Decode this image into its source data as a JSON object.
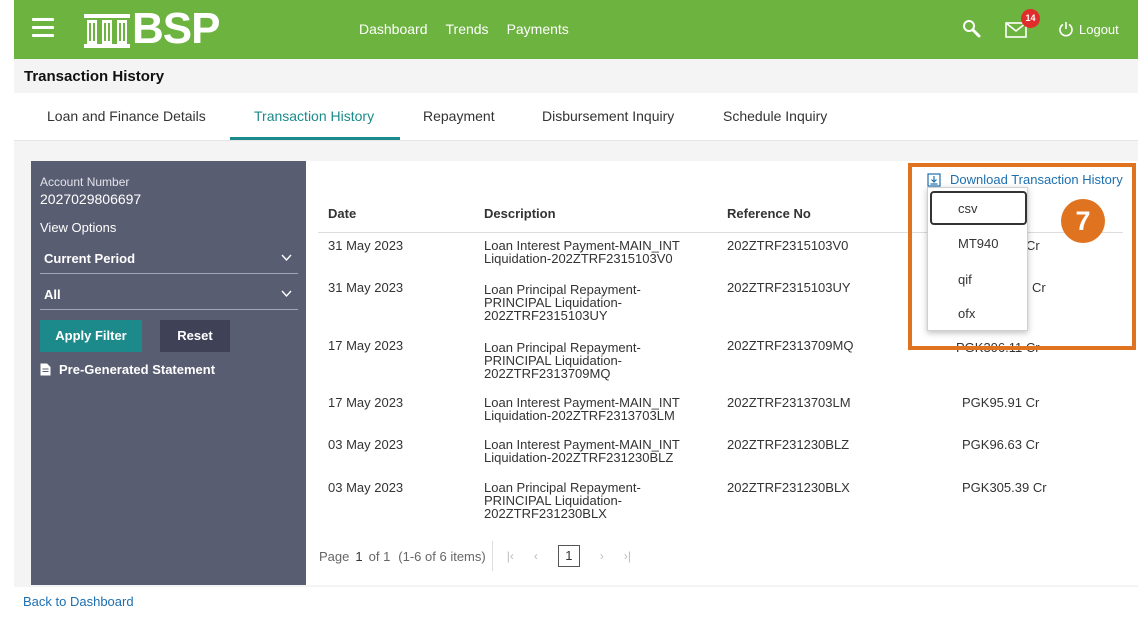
{
  "header": {
    "logo_text": "BSP",
    "nav": [
      "Dashboard",
      "Trends",
      "Payments"
    ],
    "mail_badge": "14",
    "logout_label": "Logout"
  },
  "page_title": "Transaction History",
  "tabs": [
    {
      "label": "Loan and Finance Details"
    },
    {
      "label": "Transaction History"
    },
    {
      "label": "Repayment"
    },
    {
      "label": "Disbursement Inquiry"
    },
    {
      "label": "Schedule Inquiry"
    }
  ],
  "filter": {
    "account_label": "Account Number",
    "account_number": "2027029806697",
    "view_options_label": "View Options",
    "period_value": "Current Period",
    "type_value": "All",
    "apply_label": "Apply Filter",
    "reset_label": "Reset",
    "pregenerated_label": "Pre-Generated Statement"
  },
  "download": {
    "link_label": "Download Transaction History",
    "options": [
      "csv",
      "MT940",
      "qif",
      "ofx"
    ]
  },
  "table": {
    "columns": [
      "Date",
      "Description",
      "Reference No"
    ],
    "rows": [
      {
        "date": "31 May 2023",
        "desc": [
          "Loan Interest Payment-MAIN_INT",
          "Liquidation-202ZTRF2315103V0"
        ],
        "ref": "202ZTRF2315103V0",
        "amount": "Cr"
      },
      {
        "date": "31 May 2023",
        "desc": [
          "Loan Principal Repayment-",
          "PRINCIPAL Liquidation-",
          "202ZTRF2315103UY"
        ],
        "ref": "202ZTRF2315103UY",
        "amount": "Cr"
      },
      {
        "date": "17 May 2023",
        "desc": [
          "Loan Principal Repayment-",
          "PRINCIPAL Liquidation-",
          "202ZTRF2313709MQ"
        ],
        "ref": "202ZTRF2313709MQ",
        "amount": "PGK306.11 Cr"
      },
      {
        "date": "17 May 2023",
        "desc": [
          "Loan Interest Payment-MAIN_INT",
          "Liquidation-202ZTRF2313703LM"
        ],
        "ref": "202ZTRF2313703LM",
        "amount": "PGK95.91 Cr"
      },
      {
        "date": "03 May 2023",
        "desc": [
          "Loan Interest Payment-MAIN_INT",
          "Liquidation-202ZTRF231230BLZ"
        ],
        "ref": "202ZTRF231230BLZ",
        "amount": "PGK96.63 Cr"
      },
      {
        "date": "03 May 2023",
        "desc": [
          "Loan Principal Repayment-",
          "PRINCIPAL Liquidation-",
          "202ZTRF231230BLX"
        ],
        "ref": "202ZTRF231230BLX",
        "amount": "PGK305.39 Cr"
      }
    ]
  },
  "pager": {
    "page_label": "Page",
    "current": "1",
    "of_label": "of 1",
    "items_label": "(1-6 of 6 items)",
    "page_box": "1"
  },
  "back_label": "Back to Dashboard",
  "callout": {
    "number": "7"
  },
  "colors": {
    "brand_green": "#6cb33f",
    "teal": "#1c8a8a",
    "panel": "#595d72",
    "callout": "#e07320"
  }
}
